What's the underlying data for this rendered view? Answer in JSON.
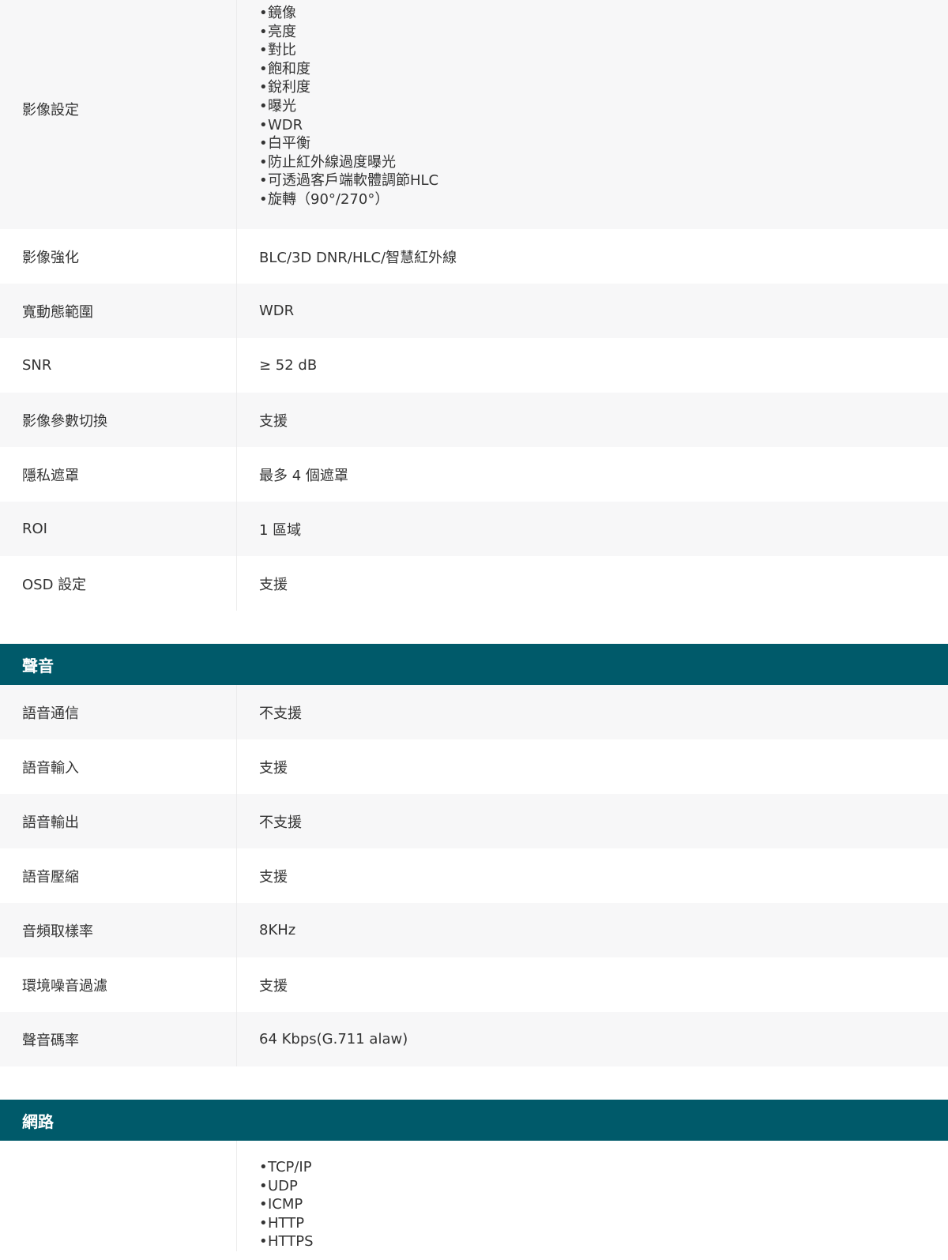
{
  "image_settings": {
    "label": "影像設定",
    "items": [
      "鏡像",
      "亮度",
      "對比",
      "飽和度",
      "銳利度",
      "曝光",
      "WDR",
      "白平衡",
      "防止紅外線過度曝光",
      "可透過客戶端軟體調節HLC",
      "旋轉（90°/270°）"
    ]
  },
  "video_rows": [
    {
      "label": "影像強化",
      "value": "BLC/3D DNR/HLC/智慧紅外線"
    },
    {
      "label": "寬動態範圍",
      "value": "WDR"
    },
    {
      "label": "SNR",
      "value": "≥ 52 dB"
    },
    {
      "label": "影像參數切換",
      "value": "支援"
    },
    {
      "label": "隱私遮罩",
      "value": "最多 4 個遮罩"
    },
    {
      "label": "ROI",
      "value": "1 區域"
    },
    {
      "label": "OSD 設定",
      "value": "支援"
    }
  ],
  "audio": {
    "title": "聲音",
    "rows": [
      {
        "label": "語音通信",
        "value": "不支援"
      },
      {
        "label": "語音輸入",
        "value": "支援"
      },
      {
        "label": "語音輸出",
        "value": "不支援"
      },
      {
        "label": "語音壓縮",
        "value": "支援"
      },
      {
        "label": "音頻取樣率",
        "value": "8KHz"
      },
      {
        "label": "環境噪音過濾",
        "value": "支援"
      },
      {
        "label": "聲音碼率",
        "value": "64 Kbps(G.711 alaw)"
      }
    ]
  },
  "network": {
    "title": "網路",
    "items": [
      "TCP/IP",
      "UDP",
      "ICMP",
      "HTTP",
      "HTTPS"
    ]
  },
  "bullet_char": "•"
}
